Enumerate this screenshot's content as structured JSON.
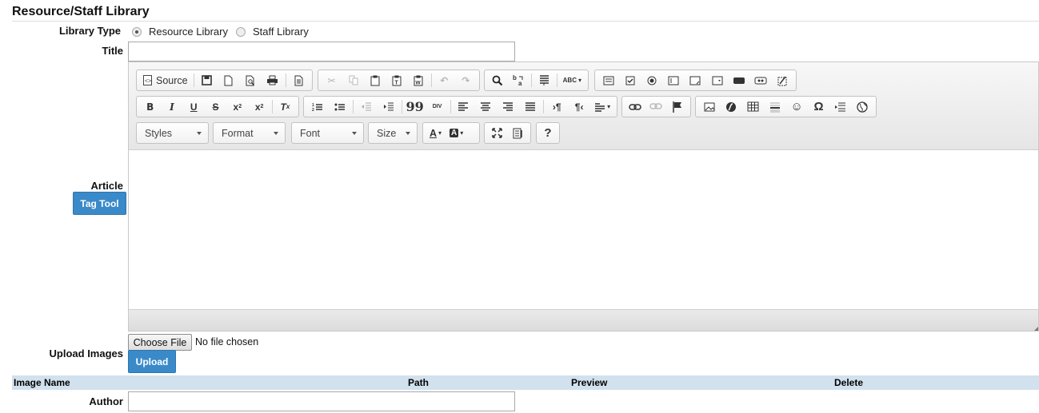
{
  "page": {
    "title": "Resource/Staff Library"
  },
  "library_type": {
    "label": "Library Type",
    "options": [
      {
        "label": "Resource Library",
        "selected": true
      },
      {
        "label": "Staff Library",
        "selected": false
      }
    ]
  },
  "title_field": {
    "label": "Title",
    "value": ""
  },
  "article": {
    "label": "Article",
    "tag_tool_label": "Tag Tool",
    "toolbar": {
      "source_label": "Source",
      "combos": {
        "styles": "Styles",
        "format": "Format",
        "font": "Font",
        "size": "Size"
      },
      "help_glyph": "?",
      "omega_glyph": "Ω",
      "quote_glyph": "99",
      "div_glyph": "DIV",
      "abc_glyph": "ABC"
    }
  },
  "upload": {
    "label": "Upload Images",
    "choose_file_label": "Choose File",
    "file_status": "No file chosen",
    "upload_label": "Upload"
  },
  "images_table": {
    "headers": [
      "Image Name",
      "Path",
      "Preview",
      "Delete"
    ]
  },
  "author_field": {
    "label": "Author",
    "value": ""
  },
  "colors": {
    "accent": "#3a8ac9",
    "table_header": "#d2e1ee"
  }
}
